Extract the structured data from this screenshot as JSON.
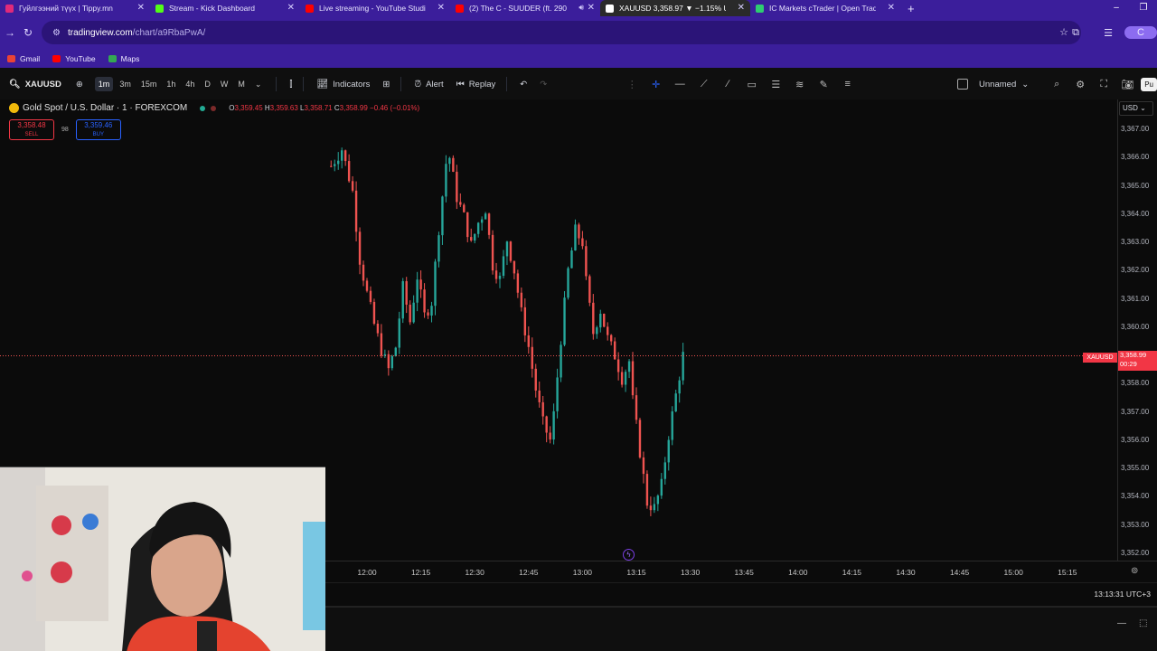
{
  "browser": {
    "tabs": [
      {
        "title": "Гуйлгээний түүх | Tippy.mn",
        "favicon_color": "#e02a7a",
        "active": false
      },
      {
        "title": "Stream - Kick Dashboard",
        "favicon_color": "#53fc18",
        "active": false
      },
      {
        "title": "Live streaming - YouTube Studio",
        "favicon_color": "#ff0000",
        "active": false
      },
      {
        "title": "(2) The C - SUUDER (ft. 290",
        "favicon_color": "#ff0000",
        "active": false
      },
      {
        "title": "XAUUSD 3,358.97 ▼ −1.15% Un",
        "favicon_color": "#ffffff",
        "active": true
      },
      {
        "title": "IC Markets cTrader | Open Trad",
        "favicon_color": "#2ecc71",
        "active": false
      }
    ],
    "url_host": "tradingview.com",
    "url_path": "/chart/a9RbaPwA/",
    "bookmarks": [
      {
        "label": "Gmail",
        "color": "#ea4335"
      },
      {
        "label": "YouTube",
        "color": "#ff0000"
      },
      {
        "label": "Maps",
        "color": "#34a853"
      }
    ],
    "profile_initial": "C"
  },
  "toolbar": {
    "symbol": "XAUUSD",
    "timeframes": [
      "1m",
      "3m",
      "15m",
      "1h",
      "4h",
      "D",
      "W",
      "M"
    ],
    "selected_timeframe": "1m",
    "indicators_label": "Indicators",
    "alert_label": "Alert",
    "replay_label": "Replay",
    "layout_name": "Unnamed",
    "publish_label": "Pu"
  },
  "legend": {
    "instrument": "Gold Spot / U.S. Dollar · 1 · FOREXCOM",
    "open_label": "O",
    "open": "3,359.45",
    "high_label": "H",
    "high": "3,359.63",
    "low_label": "L",
    "low": "3,358.71",
    "close_label": "C",
    "close": "3,358.99",
    "change": "−0.46 (−0.01%)",
    "sell_price": "3,358.48",
    "sell_label": "SELL",
    "spread": "98",
    "buy_price": "3,359.46",
    "buy_label": "BUY"
  },
  "price_axis": {
    "currency": "USD",
    "ticks": [
      "3,367.00",
      "3,366.00",
      "3,365.00",
      "3,364.00",
      "3,363.00",
      "3,362.00",
      "3,361.00",
      "3,360.00",
      "3,358.00",
      "3,357.00",
      "3,356.00",
      "3,355.00",
      "3,354.00",
      "3,353.00",
      "3,352.00"
    ],
    "current_symbol": "XAUUSD",
    "current_price": "3,358.99",
    "countdown": "00:29"
  },
  "time_axis": {
    "ticks": [
      "12:00",
      "12:15",
      "12:30",
      "12:45",
      "13:00",
      "13:15",
      "13:30",
      "13:45",
      "14:00",
      "14:15",
      "14:30",
      "14:45",
      "15:00",
      "15:15"
    ],
    "clock": "13:13:31 UTC+3"
  },
  "colors": {
    "up": "#26a69a",
    "down": "#ef5350",
    "bg": "#0b0b0b",
    "accent": "#3b1e9b"
  },
  "chart_data": {
    "type": "candlestick",
    "timeframe": "1m",
    "ylim": [
      3352.0,
      3367.0
    ],
    "last_price": 3358.99,
    "anchors": [
      {
        "t": "11:50",
        "v": 3365.7
      },
      {
        "t": "11:53",
        "v": 3366.3
      },
      {
        "t": "11:56",
        "v": 3364.8
      },
      {
        "t": "11:58",
        "v": 3362.4
      },
      {
        "t": "12:00",
        "v": 3361.2
      },
      {
        "t": "12:02",
        "v": 3360.1
      },
      {
        "t": "12:04",
        "v": 3359.2
      },
      {
        "t": "12:06",
        "v": 3358.5
      },
      {
        "t": "12:08",
        "v": 3359.3
      },
      {
        "t": "12:10",
        "v": 3361.4
      },
      {
        "t": "12:12",
        "v": 3360.2
      },
      {
        "t": "12:14",
        "v": 3361.8
      },
      {
        "t": "12:16",
        "v": 3360.4
      },
      {
        "t": "12:18",
        "v": 3360.9
      },
      {
        "t": "12:20",
        "v": 3363.5
      },
      {
        "t": "12:22",
        "v": 3365.8
      },
      {
        "t": "12:23",
        "v": 3366.0
      },
      {
        "t": "12:25",
        "v": 3364.6
      },
      {
        "t": "12:27",
        "v": 3363.9
      },
      {
        "t": "12:29",
        "v": 3362.9
      },
      {
        "t": "12:31",
        "v": 3363.7
      },
      {
        "t": "12:33",
        "v": 3364.2
      },
      {
        "t": "12:35",
        "v": 3362.2
      },
      {
        "t": "12:37",
        "v": 3361.7
      },
      {
        "t": "12:39",
        "v": 3363.1
      },
      {
        "t": "12:41",
        "v": 3362.0
      },
      {
        "t": "12:43",
        "v": 3360.5
      },
      {
        "t": "12:45",
        "v": 3359.3
      },
      {
        "t": "12:47",
        "v": 3357.8
      },
      {
        "t": "12:49",
        "v": 3356.6
      },
      {
        "t": "12:51",
        "v": 3356.0
      },
      {
        "t": "12:52",
        "v": 3356.9
      },
      {
        "t": "12:54",
        "v": 3359.6
      },
      {
        "t": "12:56",
        "v": 3362.0
      },
      {
        "t": "12:58",
        "v": 3363.4
      },
      {
        "t": "13:00",
        "v": 3363.0
      },
      {
        "t": "13:01",
        "v": 3361.6
      },
      {
        "t": "13:03",
        "v": 3359.8
      },
      {
        "t": "13:05",
        "v": 3360.6
      },
      {
        "t": "13:07",
        "v": 3359.6
      },
      {
        "t": "13:09",
        "v": 3359.0
      },
      {
        "t": "13:11",
        "v": 3358.2
      },
      {
        "t": "13:13",
        "v": 3358.8
      },
      {
        "t": "13:14",
        "v": 3357.4
      },
      {
        "t": "13:16",
        "v": 3355.6
      },
      {
        "t": "13:18",
        "v": 3353.8
      },
      {
        "t": "13:20",
        "v": 3353.6
      },
      {
        "t": "13:22",
        "v": 3354.4
      },
      {
        "t": "13:24",
        "v": 3356.2
      },
      {
        "t": "13:26",
        "v": 3357.6
      },
      {
        "t": "13:27",
        "v": 3358.3
      },
      {
        "t": "13:28",
        "v": 3359.0
      }
    ]
  }
}
